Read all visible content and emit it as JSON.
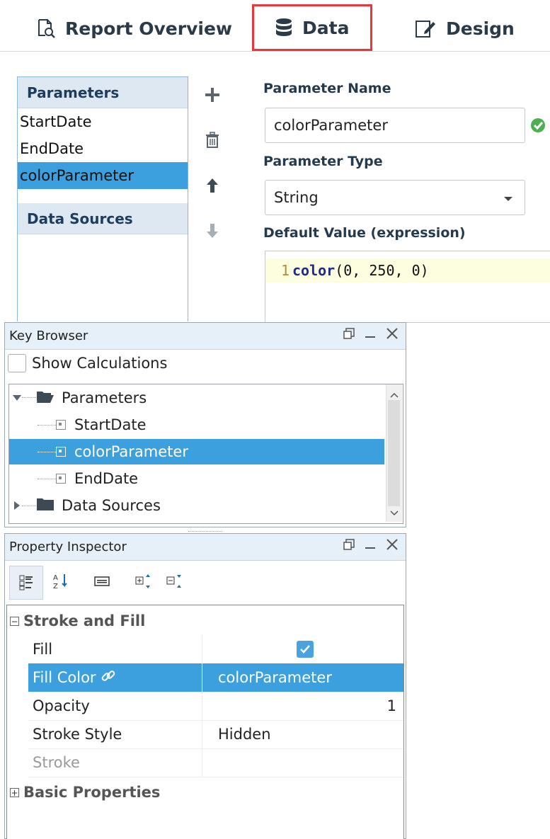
{
  "tabs": {
    "report_overview": "Report Overview",
    "data": "Data",
    "design": "Design"
  },
  "parameters_panel": {
    "header": "Parameters",
    "items": [
      "StartDate",
      "EndDate",
      "colorParameter"
    ],
    "selected": "colorParameter",
    "data_sources_header": "Data Sources"
  },
  "param_editor": {
    "name_label": "Parameter Name",
    "name_value": "colorParameter",
    "type_label": "Parameter Type",
    "type_value": "String",
    "default_label": "Default Value (expression)",
    "line_number": "1",
    "code_func": "color",
    "code_args": "(0, 250, 0)"
  },
  "key_browser": {
    "title": "Key Browser",
    "show_calculations": "Show Calculations",
    "tree": {
      "parameters": "Parameters",
      "children": [
        "StartDate",
        "colorParameter",
        "EndDate"
      ],
      "data_sources": "Data Sources"
    }
  },
  "property_inspector": {
    "title": "Property Inspector",
    "category_stroke_fill": "Stroke and Fill",
    "rows": [
      {
        "key": "Fill",
        "value": ""
      },
      {
        "key": "Fill Color",
        "value": "colorParameter"
      },
      {
        "key": "Opacity",
        "value": "1"
      },
      {
        "key": "Stroke Style",
        "value": "Hidden"
      },
      {
        "key": "Stroke",
        "value": ""
      }
    ],
    "category_basic": "Basic Properties"
  },
  "colors": {
    "selection": "#3ca0de",
    "tab_highlight": "#e8383a",
    "valid_check": "#4caf50"
  }
}
